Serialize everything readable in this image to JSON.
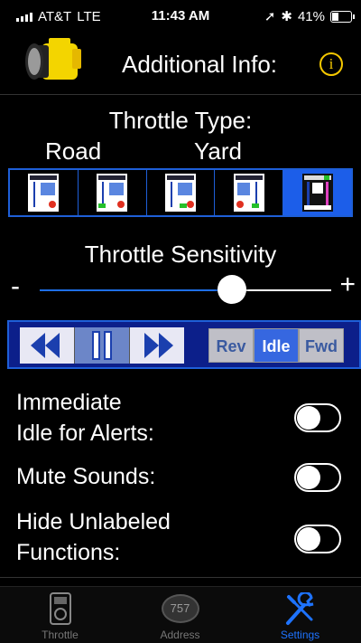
{
  "status_bar": {
    "carrier": "AT&T",
    "network": "LTE",
    "time": "11:43 AM",
    "battery": "41%",
    "battery_level": 0.41
  },
  "header": {
    "title": "Additional Info:",
    "info_glyph": "i"
  },
  "throttle_type": {
    "title": "Throttle Type:",
    "road_label": "Road",
    "yard_label": "Yard",
    "options": [
      "road-throttle-1",
      "road-throttle-2",
      "yard-throttle-1",
      "yard-throttle-2",
      "yard-throttle-3"
    ],
    "selected_index": 4
  },
  "sensitivity": {
    "title": "Throttle Sensitivity",
    "minus": "-",
    "plus": "+",
    "value": 0.66
  },
  "direction": {
    "modes": [
      "Rev",
      "Idle",
      "Fwd"
    ],
    "selected": "Idle"
  },
  "toggles": [
    {
      "label_line1": "Immediate",
      "label_line2": "Idle for Alerts:",
      "on": false
    },
    {
      "label_line1": "Mute Sounds:",
      "label_line2": "",
      "on": false
    },
    {
      "label_line1": "Hide Unlabeled",
      "label_line2": "Functions:",
      "on": false
    }
  ],
  "tabs": [
    {
      "label": "Throttle",
      "icon": "throttle-icon"
    },
    {
      "label": "Address",
      "icon": "address-icon",
      "badge": "757"
    },
    {
      "label": "Settings",
      "icon": "wrench-icon",
      "active": true
    }
  ],
  "colors": {
    "accent": "#1e5fd8",
    "info": "#f5c800",
    "active_tab": "#1e73ff"
  }
}
